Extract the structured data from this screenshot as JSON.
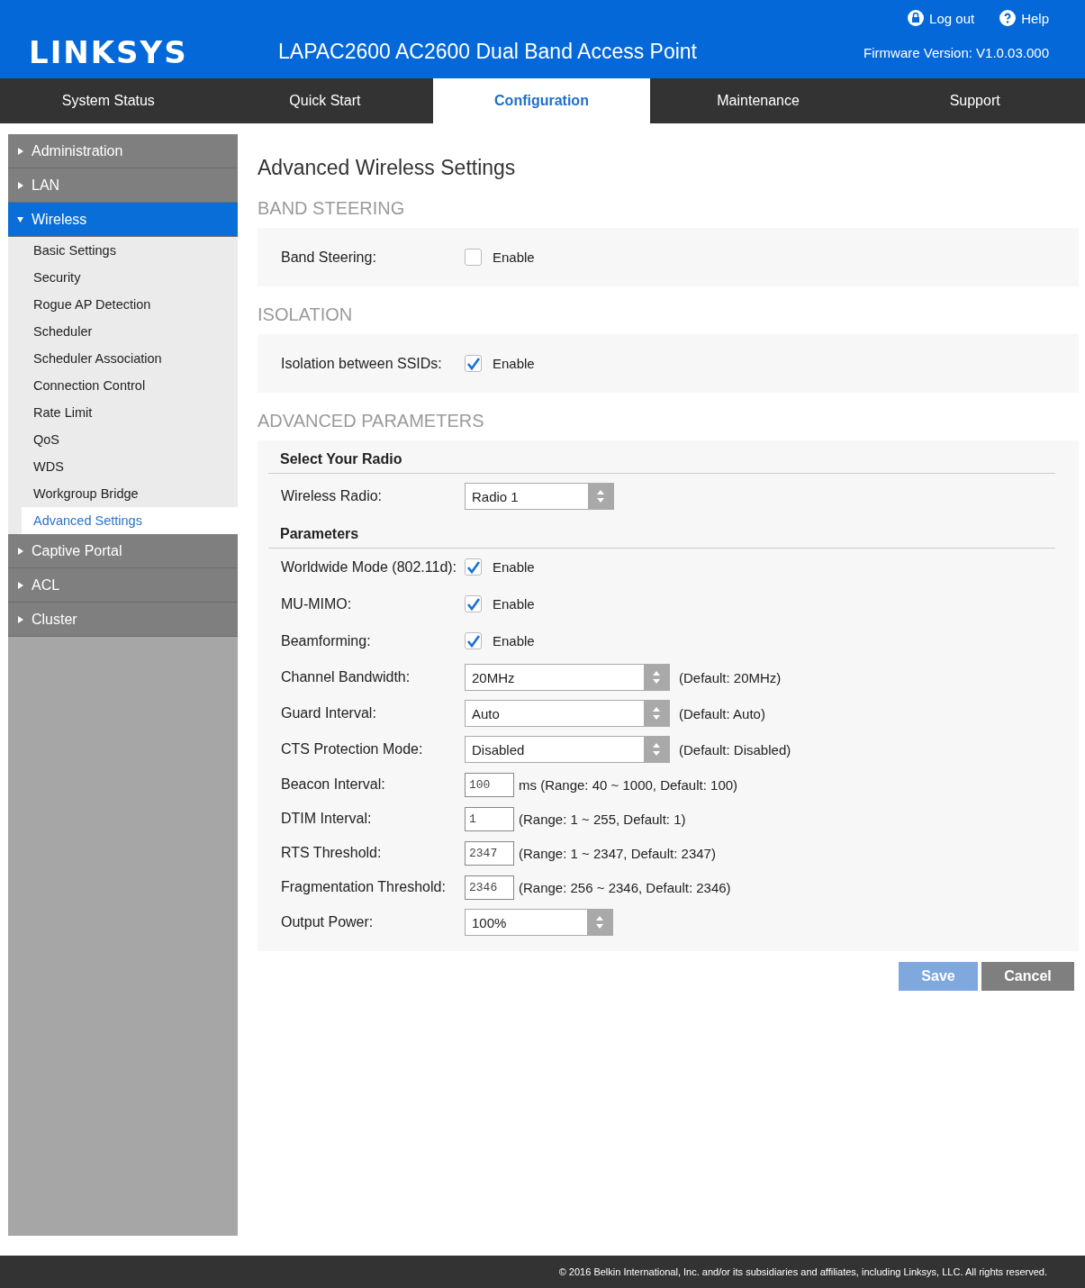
{
  "header": {
    "logo": "LINKSYS",
    "title": "LAPAC2600 AC2600 Dual Band Access Point",
    "logout": "Log out",
    "help": "Help",
    "firmware": "Firmware Version: V1.0.03.000"
  },
  "tabs": [
    {
      "label": "System Status",
      "selected": false
    },
    {
      "label": "Quick Start",
      "selected": false
    },
    {
      "label": "Configuration",
      "selected": true
    },
    {
      "label": "Maintenance",
      "selected": false
    },
    {
      "label": "Support",
      "selected": false
    }
  ],
  "sidebar": {
    "items": [
      {
        "label": "Administration",
        "expanded": false,
        "selected": false
      },
      {
        "label": "LAN",
        "expanded": false,
        "selected": false
      },
      {
        "label": "Wireless",
        "expanded": true,
        "selected": true,
        "children": [
          {
            "label": "Basic Settings",
            "selected": false
          },
          {
            "label": "Security",
            "selected": false
          },
          {
            "label": "Rogue AP Detection",
            "selected": false
          },
          {
            "label": "Scheduler",
            "selected": false
          },
          {
            "label": "Scheduler Association",
            "selected": false
          },
          {
            "label": "Connection Control",
            "selected": false
          },
          {
            "label": "Rate Limit",
            "selected": false
          },
          {
            "label": "QoS",
            "selected": false
          },
          {
            "label": "WDS",
            "selected": false
          },
          {
            "label": "Workgroup Bridge",
            "selected": false
          },
          {
            "label": "Advanced Settings",
            "selected": true
          }
        ]
      },
      {
        "label": "Captive Portal",
        "expanded": false,
        "selected": false
      },
      {
        "label": "ACL",
        "expanded": false,
        "selected": false
      },
      {
        "label": "Cluster",
        "expanded": false,
        "selected": false
      }
    ]
  },
  "page_title": "Advanced Wireless Settings",
  "band_steering": {
    "heading": "BAND STEERING",
    "label": "Band Steering:",
    "checked": false,
    "option": "Enable"
  },
  "isolation": {
    "heading": "ISOLATION",
    "label": "Isolation between SSIDs:",
    "checked": true,
    "option": "Enable"
  },
  "advanced": {
    "heading": "ADVANCED PARAMETERS",
    "radio_heading": "Select Your Radio",
    "radio_label": "Wireless Radio:",
    "radio_value": "Radio 1",
    "params_heading": "Parameters",
    "params": [
      {
        "kind": "checkbox",
        "label": "Worldwide Mode (802.11d):",
        "checked": true,
        "option": "Enable"
      },
      {
        "kind": "checkbox",
        "label": "MU-MIMO:",
        "checked": true,
        "option": "Enable"
      },
      {
        "kind": "checkbox",
        "label": "Beamforming:",
        "checked": true,
        "option": "Enable"
      },
      {
        "kind": "select",
        "label": "Channel Bandwidth:",
        "value": "20MHz",
        "note": "(Default: 20MHz)"
      },
      {
        "kind": "select",
        "label": "Guard Interval:",
        "value": "Auto",
        "note": "(Default: Auto)"
      },
      {
        "kind": "select",
        "label": "CTS Protection Mode:",
        "value": "Disabled",
        "note": "(Default: Disabled)"
      },
      {
        "kind": "input",
        "label": "Beacon Interval:",
        "value": "100",
        "note": "ms (Range: 40 ~ 1000, Default: 100)"
      },
      {
        "kind": "input",
        "label": "DTIM Interval:",
        "value": "1",
        "note": "(Range: 1 ~ 255, Default: 1)"
      },
      {
        "kind": "input",
        "label": "RTS Threshold:",
        "value": "2347",
        "note": "(Range: 1 ~ 2347, Default: 2347)"
      },
      {
        "kind": "input",
        "label": "Fragmentation Threshold:",
        "value": "2346",
        "note": "(Range: 256 ~ 2346, Default: 2346)"
      },
      {
        "kind": "short_select",
        "label": "Output Power:",
        "value": "100%"
      }
    ]
  },
  "buttons": {
    "save": "Save",
    "cancel": "Cancel"
  },
  "footer": "© 2016 Belkin International, Inc. and/or its subsidiaries and affiliates, including Linksys, LLC. All rights reserved."
}
